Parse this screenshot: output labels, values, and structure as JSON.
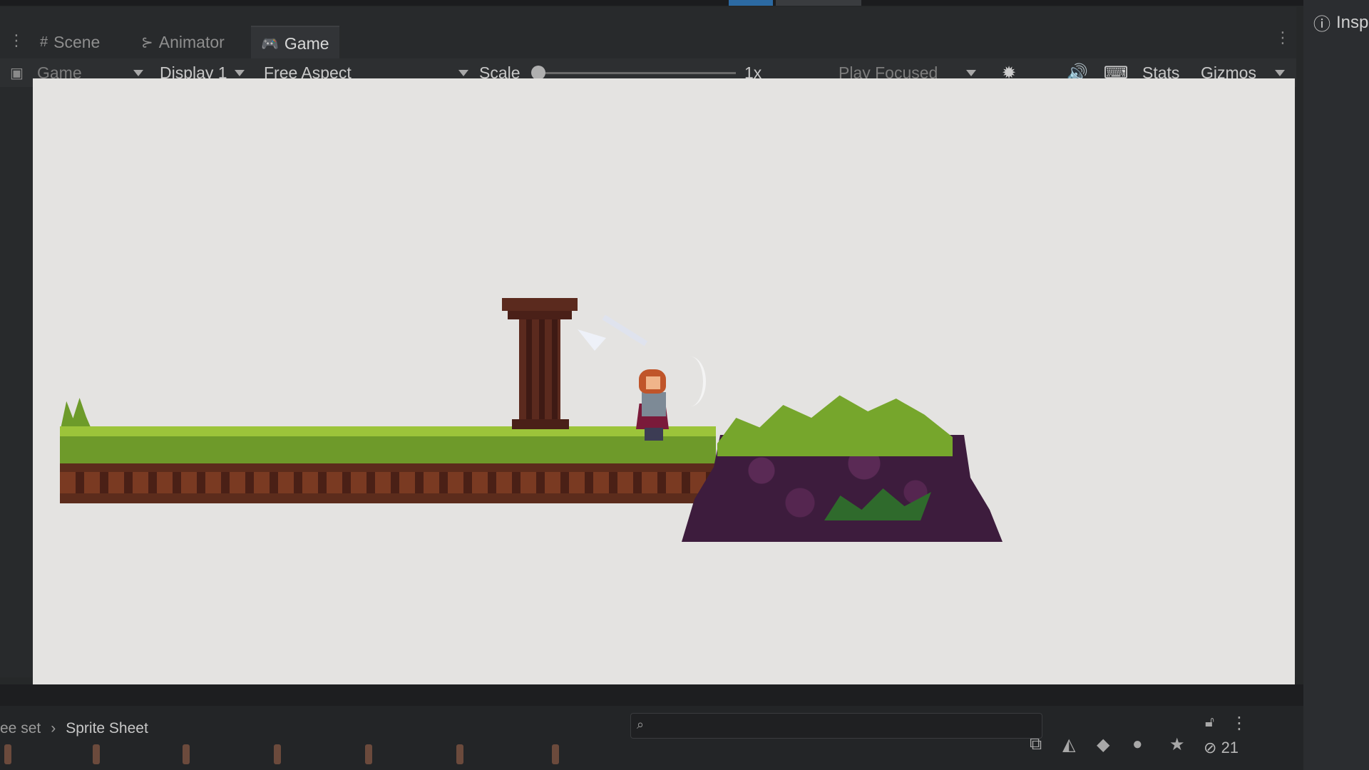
{
  "tabs": {
    "scene": "Scene",
    "animator": "Animator",
    "game": "Game"
  },
  "toolbar": {
    "game_dropdown": "Game",
    "display": "Display 1",
    "aspect": "Free Aspect",
    "scale_label": "Scale",
    "scale_value": "1x",
    "play_mode": "Play Focused",
    "stats": "Stats",
    "gizmos": "Gizmos"
  },
  "inspector": {
    "tab_label": "Insp"
  },
  "bottom_panel": {
    "breadcrumb_parent": "ee set",
    "breadcrumb_current": "Sprite Sheet",
    "hidden_count": "21"
  },
  "icons": {
    "scene": "grid-icon",
    "animator": "animator-icon",
    "game": "gamepad-icon",
    "bug": "bug-icon",
    "audio": "speaker-icon",
    "keyboard": "keyboard-icon",
    "info": "info-icon",
    "search": "search-icon",
    "lock": "lock-icon"
  },
  "colors": {
    "accent": "#2c6aa3",
    "viewport_bg": "#e4e3e1",
    "editor_bg": "#262829"
  }
}
